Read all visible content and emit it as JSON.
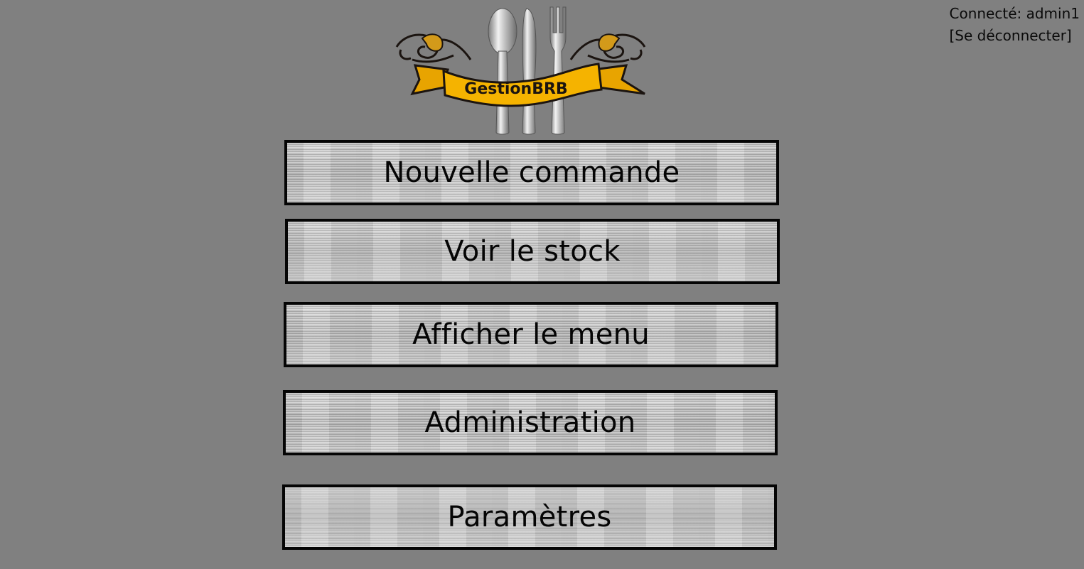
{
  "header": {
    "connected_label": "Connecté: admin1",
    "logout_label": "[Se déconnecter]"
  },
  "logo": {
    "text": "GestionBRB",
    "banner_color": "#f5b300",
    "icon": "cutlery-icon"
  },
  "menu": {
    "buttons": [
      {
        "label": "Nouvelle commande"
      },
      {
        "label": "Voir le stock"
      },
      {
        "label": "Afficher le menu"
      },
      {
        "label": "Administration"
      },
      {
        "label": "Paramètres"
      }
    ]
  },
  "colors": {
    "background": "#808080",
    "button_border": "#050505",
    "button_fill": "#c9c9c9"
  }
}
